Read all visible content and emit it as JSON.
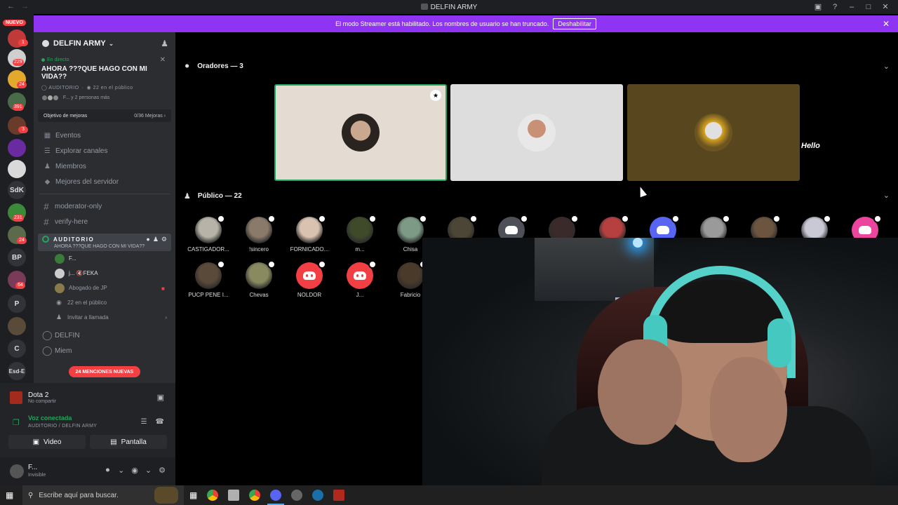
{
  "window": {
    "title": "DELFIN ARMY"
  },
  "banner": {
    "text": "El modo Streamer está habilitado. Los nombres de usuario se han truncado.",
    "button": "Deshabilitar"
  },
  "rail": {
    "nuevo": "NUEVO",
    "badges": [
      "2",
      "1",
      "229",
      "24",
      "391",
      "3",
      "231",
      "24",
      "64"
    ],
    "labels": [
      "SdK",
      "BP",
      "P",
      "C",
      "Esd-E"
    ]
  },
  "sidebar": {
    "server_name": "DELFIN ARMY",
    "stage": {
      "live": "En directo",
      "topic": "AHORA ???QUE HAGO CON MI VIDA??",
      "channel": "AUDITORIO",
      "audience": "22 en el público",
      "people": "F... y 2 personas más"
    },
    "boost": {
      "label": "Objetivo de mejoras",
      "value": "0/36 Mejoras"
    },
    "nav": [
      "Eventos",
      "Explorar canales",
      "Miembros",
      "Mejores del servidor"
    ],
    "channels": [
      "moderator-only",
      "verify-here"
    ],
    "active_channel": {
      "name": "AUDITORIO",
      "topic": "AHORA ???QUE HAGO CON MI VIDA??"
    },
    "members": [
      {
        "name": "F..."
      },
      {
        "name": "j... 🔇FEKA"
      },
      {
        "name": "Abogado de JP"
      }
    ],
    "audience_row": "22 en el público",
    "invite_row": "Invitar a llamada",
    "after": [
      "DELFIN",
      "Miem"
    ],
    "mentions": "24 MENCIONES NUEVAS"
  },
  "user_area": {
    "activity_title": "Dota 2",
    "activity_sub": "No compartir",
    "voice_title": "Voz conectada",
    "voice_sub": "AUDITORIO / DELFIN ARMY",
    "video_button": "Video",
    "screen_button": "Pantalla",
    "username": "F...",
    "status": "Invisible"
  },
  "stage": {
    "speakers_header": "Oradores — 3",
    "audience_header": "Público — 22",
    "hello_text": "Hello",
    "audience": [
      {
        "name": "CASTIGADOR...",
        "type": "photo",
        "color": "#b8b3a8"
      },
      {
        "name": "!sincero",
        "type": "photo",
        "color": "#8a7a6a"
      },
      {
        "name": "FORNICADO...",
        "type": "photo",
        "color": "#d9c2b0"
      },
      {
        "name": "m...",
        "type": "photo",
        "color": "#3e4a2a"
      },
      {
        "name": "Chisa",
        "type": "photo",
        "color": "#7d9a86"
      },
      {
        "name": "",
        "type": "photo",
        "color": "#4c4636"
      },
      {
        "name": "",
        "type": "discord",
        "color": "gray"
      },
      {
        "name": "",
        "type": "photo",
        "color": "#3a2a2a"
      },
      {
        "name": "",
        "type": "photo",
        "color": "#b64040"
      },
      {
        "name": "",
        "type": "discord",
        "color": "blurple"
      },
      {
        "name": "",
        "type": "photo",
        "color": "#9a9a9a"
      },
      {
        "name": "",
        "type": "photo",
        "color": "#6b5540"
      },
      {
        "name": "",
        "type": "photo",
        "color": "#c9c9d6"
      },
      {
        "name": "",
        "type": "discord",
        "color": "pink"
      },
      {
        "name": "PUCP PENE I...",
        "type": "photo",
        "color": "#5a4a3a"
      },
      {
        "name": "Chevas",
        "type": "photo",
        "color": "#8a8a60"
      },
      {
        "name": "NOLDOR",
        "type": "discord",
        "color": "red"
      },
      {
        "name": "J...",
        "type": "discord",
        "color": "red"
      },
      {
        "name": "Fabricio",
        "type": "photo",
        "color": "#4a3a2a"
      }
    ]
  },
  "taskbar": {
    "search_placeholder": "Escribe aquí para buscar."
  }
}
